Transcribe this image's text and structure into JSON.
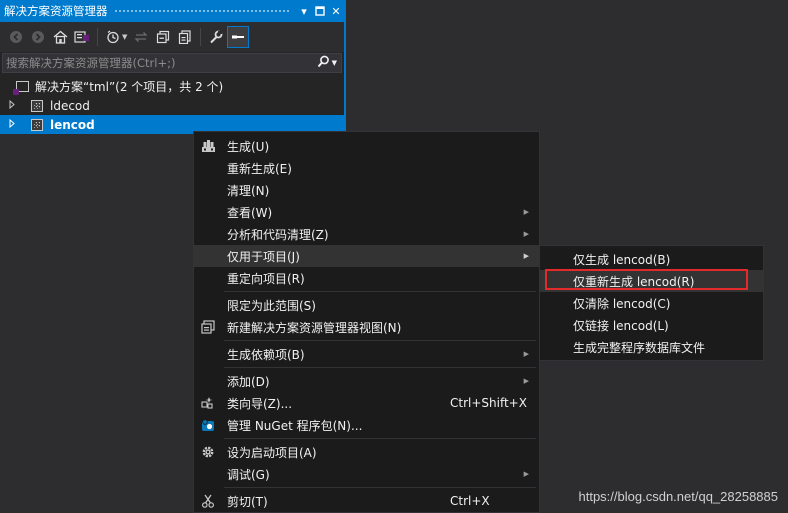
{
  "window": {
    "title": "解决方案资源管理器",
    "pin_glyph": "▾",
    "maximize_glyph": "▫",
    "close_glyph": "✕"
  },
  "toolbar": {
    "icons": [
      "back-icon",
      "forward-icon",
      "home-icon",
      "switch-views-icon",
      "pending-changes-filter-icon",
      "sync-icon",
      "collapse-all-icon",
      "show-all-files-icon",
      "properties-icon",
      "preview-selected-icon"
    ]
  },
  "search": {
    "placeholder": "搜索解决方案资源管理器(Ctrl+;)",
    "value": ""
  },
  "tree": {
    "solution": "解决方案“tml”(2 个项目，共 2 个)",
    "projects": [
      {
        "label": "ldecod",
        "selected": false
      },
      {
        "label": "lencod",
        "selected": true
      }
    ]
  },
  "context_menu": {
    "items": [
      {
        "label": "生成(U)",
        "icon": "build-icon"
      },
      {
        "label": "重新生成(E)"
      },
      {
        "label": "清理(N)"
      },
      {
        "label": "查看(W)",
        "submenu": true
      },
      {
        "label": "分析和代码清理(Z)",
        "submenu": true
      },
      {
        "label": "仅用于项目(J)",
        "submenu": true,
        "hover": true
      },
      {
        "label": "重定向项目(R)"
      },
      {
        "label": "限定为此范围(S)"
      },
      {
        "label": "新建解决方案资源管理器视图(N)",
        "icon": "new-view-icon"
      },
      {
        "label": "生成依赖项(B)",
        "submenu": true
      },
      {
        "label": "添加(D)",
        "submenu": true
      },
      {
        "label": "类向导(Z)...",
        "icon": "class-wizard-icon",
        "shortcut": "Ctrl+Shift+X"
      },
      {
        "label": "管理 NuGet 程序包(N)...",
        "icon": "nuget-icon"
      },
      {
        "label": "设为启动项目(A)",
        "icon": "gear-icon"
      },
      {
        "label": "调试(G)",
        "submenu": true
      },
      {
        "label": "剪切(T)",
        "icon": "cut-icon",
        "shortcut": "Ctrl+X"
      }
    ]
  },
  "submenu": {
    "items": [
      {
        "label": "仅生成 lencod(B)"
      },
      {
        "label": "仅重新生成 lencod(R)",
        "hover": true,
        "highlighted": true
      },
      {
        "label": "仅清除 lencod(C)"
      },
      {
        "label": "仅链接 lencod(L)"
      },
      {
        "label": "生成完整程序数据库文件"
      }
    ]
  },
  "watermark": "https://blog.csdn.net/qq_28258885",
  "colors": {
    "accent": "#007acc",
    "background": "#2d2d30",
    "menu_background": "#1b1b1c",
    "highlight_border": "#e32a2a"
  }
}
